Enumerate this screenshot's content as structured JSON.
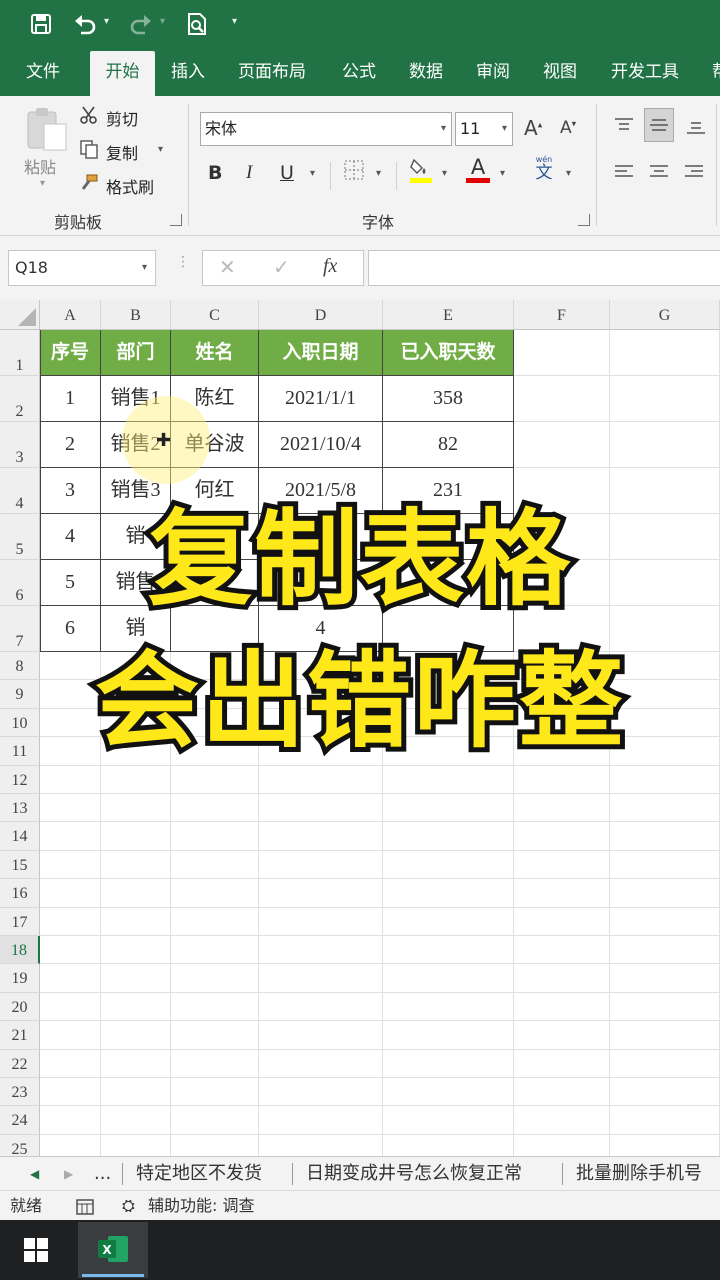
{
  "quick_access": {
    "icons": [
      "save-icon",
      "undo-icon",
      "redo-icon",
      "print-preview-icon",
      "customize-icon"
    ]
  },
  "tabs": [
    {
      "label": "文件"
    },
    {
      "label": "开始"
    },
    {
      "label": "插入"
    },
    {
      "label": "页面布局"
    },
    {
      "label": "公式"
    },
    {
      "label": "数据"
    },
    {
      "label": "审阅"
    },
    {
      "label": "视图"
    },
    {
      "label": "开发工具"
    },
    {
      "label": "帮"
    }
  ],
  "ribbon": {
    "clipboard": {
      "paste_label": "粘贴",
      "cut_label": "剪切",
      "copy_label": "复制",
      "format_painter_label": "格式刷",
      "group_label": "剪贴板"
    },
    "font": {
      "font_name": "宋体",
      "font_size": "11",
      "grow_label": "A",
      "shrink_label": "A",
      "bold_label": "B",
      "italic_label": "I",
      "underline_label": "U",
      "font_color_label": "A",
      "phonetic_label": "文",
      "phonetic_top": "wén",
      "group_label": "字体",
      "fill_color": "#ffff00",
      "font_color": "#e00000"
    }
  },
  "formula_bar": {
    "name_box": "Q18",
    "cancel": "✕",
    "enter": "✓",
    "fx": "fx",
    "value": ""
  },
  "sheet": {
    "columns": [
      "A",
      "B",
      "C",
      "D",
      "E",
      "F",
      "G"
    ],
    "rows": [
      "1",
      "2",
      "3",
      "4",
      "5",
      "6",
      "7",
      "8",
      "9",
      "10",
      "11",
      "12",
      "13",
      "14",
      "15",
      "16",
      "17",
      "18",
      "19",
      "20",
      "21",
      "22",
      "23",
      "24",
      "25"
    ],
    "selected_row": "18",
    "header": [
      "序号",
      "部门",
      "姓名",
      "入职日期",
      "已入职天数"
    ],
    "data": [
      [
        "1",
        "销售1",
        "陈红",
        "2021/1/1",
        "358"
      ],
      [
        "2",
        "销售2",
        "单谷波",
        "2021/10/4",
        "82"
      ],
      [
        "3",
        "销售3",
        "何红",
        "2021/5/8",
        "231"
      ],
      [
        "4",
        "销",
        "",
        "1",
        ""
      ],
      [
        "5",
        "销售",
        "",
        "",
        ""
      ],
      [
        "6",
        "销",
        "",
        "4",
        ""
      ]
    ],
    "header_color": "#70ad47"
  },
  "overlay": {
    "line1": "复制表格",
    "line2": "会出错咋整"
  },
  "sheet_tabs": {
    "more": "...",
    "tabs": [
      "特定地区不发货",
      "日期变成井号怎么恢复正常",
      "批量删除手机号"
    ]
  },
  "status_bar": {
    "ready": "就绪",
    "accessibility": "辅助功能: 调查"
  },
  "colors": {
    "excel_green": "#217346",
    "overlay_yellow": "#ffe81a"
  }
}
